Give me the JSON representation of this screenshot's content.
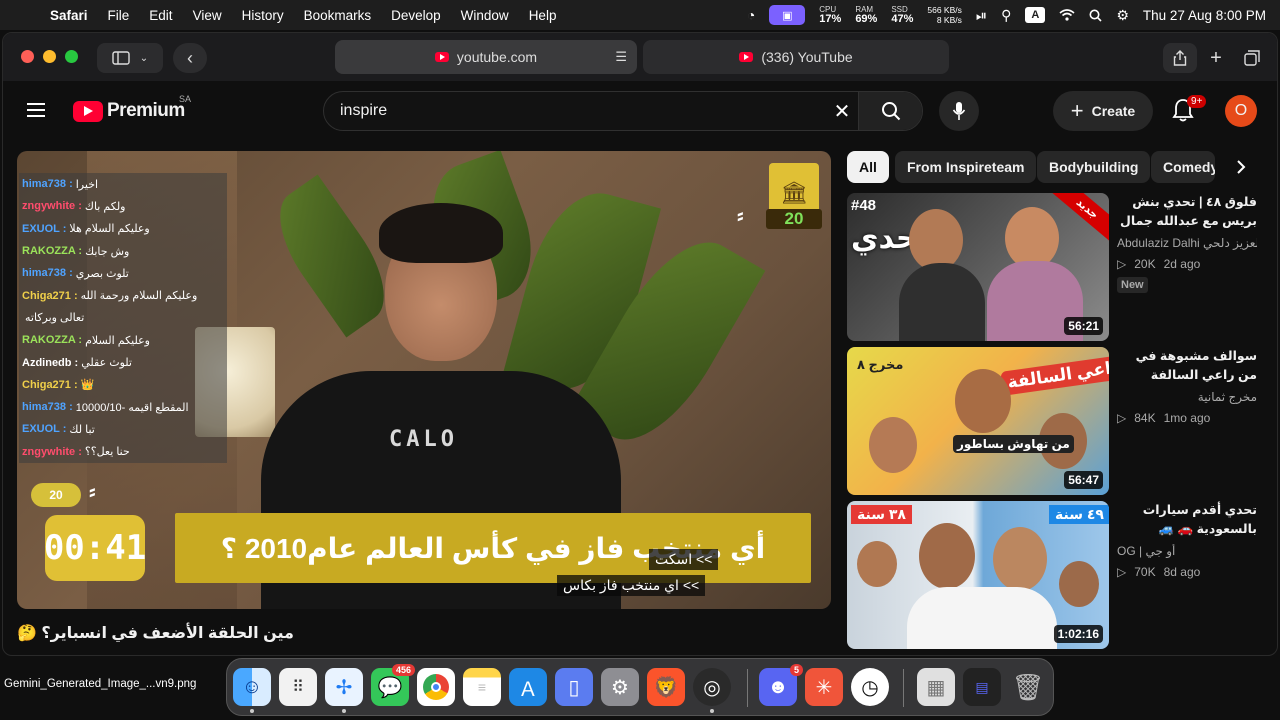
{
  "menubar": {
    "app": "Safari",
    "items": [
      "File",
      "Edit",
      "View",
      "History",
      "Bookmarks",
      "Develop",
      "Window",
      "Help"
    ],
    "cpu_label": "CPU",
    "cpu": "17%",
    "ram_label": "RAM",
    "ram": "69%",
    "ssd_label": "SSD",
    "ssd": "47%",
    "net_up": "566 KB/s",
    "net_down": "8 KB/s",
    "keyboard": "A",
    "clock": "Thu 27 Aug  8:00 PM"
  },
  "safari": {
    "address": "youtube.com",
    "tab_title": "(336) YouTube"
  },
  "youtube": {
    "logo": "Premium",
    "country": "SA",
    "search_value": "inspire",
    "create_label": "Create",
    "notif_count": "9+",
    "avatar_letter": "O"
  },
  "player": {
    "chat": [
      {
        "user": "hima738 :",
        "msg": "اخيرا",
        "color": "#4fa3ff"
      },
      {
        "user": "zngywhite :",
        "msg": "ولكم باك",
        "color": "#ff4d6d"
      },
      {
        "user": "EXUOL :",
        "msg": "وعليكم السلام هلا",
        "color": "#4fa3ff"
      },
      {
        "user": "RAKOZZA :",
        "msg": "وش جابك",
        "color": "#9be35a"
      },
      {
        "user": "hima738 :",
        "msg": "تلوث بصري",
        "color": "#4fa3ff"
      },
      {
        "user": "Chiga271 :",
        "msg": "وعليكم السلام ورحمة الله",
        "color": "#f0d04a"
      },
      {
        "user": "",
        "msg": "تعالى وبركاته",
        "color": "#ffffff"
      },
      {
        "user": "RAKOZZA :",
        "msg": "وعليكم السلام",
        "color": "#9be35a"
      },
      {
        "user": "Azdinedb :",
        "msg": "تلوث عقلي",
        "color": "#ffffff"
      },
      {
        "user": "Chiga271 :",
        "msg": "👑",
        "color": "#f0d04a"
      },
      {
        "user": "hima738 :",
        "msg": "10000/10- المقطع اقيمه",
        "color": "#4fa3ff"
      },
      {
        "user": "EXUOL :",
        "msg": "تبا لك",
        "color": "#4fa3ff"
      },
      {
        "user": "zngywhite :",
        "msg": "حنا يعل؟؟",
        "color": "#ff4d6d"
      }
    ],
    "score": "20",
    "round": "20",
    "timer": "00:41",
    "question": "أي منتخب فاز في كأس العالم عام2010 ؟",
    "caption_1": ">> اسكت",
    "caption_2": ">> اي منتخب فاز بكاس",
    "shirt_text": "CALO"
  },
  "video_title": "مين الحلقة الأضعف في انسباير؟ 🤔",
  "chips": [
    "All",
    "From Inspireteam",
    "Bodybuilding",
    "Comedy"
  ],
  "recommendations": [
    {
      "title": "فلوق ٤٨ | تحدي بنش بريس مع عبدالله جمال 💪",
      "channel": "Abdulaziz Dalhi عبدالعزيز دلحي",
      "views": "20K",
      "age": "2d ago",
      "badge": "New",
      "duration": "56:21",
      "thumb_label": "#48",
      "thumb_text": "التحدي",
      "thumb_ribbon": "جديد"
    },
    {
      "title": "سوالف مشبوهة في من راعي السالفة",
      "channel": "مخرج ثمانية",
      "views": "84K",
      "age": "1mo ago",
      "duration": "56:47",
      "thumb_label": "مخرج ٨",
      "thumb_text": "من راعي السالفة",
      "thumb_sub": "من تهاوش بساطور"
    },
    {
      "title": "تحدي أقدم سيارات بالسعودية 🚗 🚙",
      "channel": "OG | أو جي",
      "views": "70K",
      "age": "8d ago",
      "duration": "1:02:16",
      "thumb_left": "٣٨ سنة",
      "thumb_right": "٤٩ سنة"
    }
  ],
  "desktop_file": "Gemini_Generated_Image_...vn9.png",
  "dock": {
    "messages_badge": "456",
    "discord_badge": "5"
  },
  "colors": {
    "yt_red": "#ff0033",
    "accent_yellow": "#e0c035",
    "background": "#0f0f0f"
  }
}
